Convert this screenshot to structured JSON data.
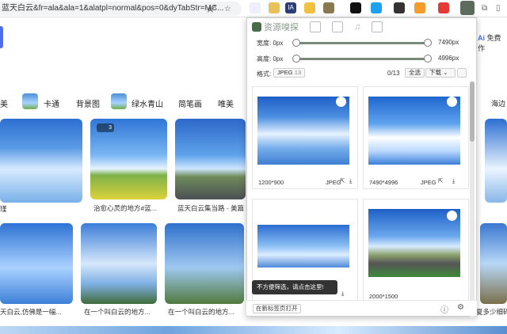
{
  "browser": {
    "url": "蓝天白云&fr=ala&ala=1&alatpl=normal&pos=0&dyTabStr=MC..."
  },
  "page": {
    "categories": [
      "美",
      "卡通",
      "背景图",
      "绿水青山",
      "简笔画",
      "唯美"
    ],
    "right_label": "海边",
    "ai_label": "免费作",
    "overlay_count": "3",
    "captions": [
      "治愈心灵的地方#蓝...",
      "蓝天白云集当路 - 美篇",
      "天白云,仿佛是一幅...",
      "在一个叫白云的地方...",
      "在一个叫白云的地方...",
      "夏多少细碎"
    ]
  },
  "panel": {
    "tabs": [
      "资源嗅探"
    ],
    "width_label": "宽度: 0px",
    "width_max": "7490px",
    "height_label": "高度: 0px",
    "height_max": "4996px",
    "format_label": "格式:",
    "format_value": "JPEG",
    "format_count": "13",
    "count": "0/13",
    "select_all": "全选",
    "download": "下载",
    "cards": [
      {
        "size": "1200*900",
        "format": "JPEG"
      },
      {
        "size": "7490*4996",
        "format": "JPEG"
      },
      {
        "size": "",
        "format": ""
      },
      {
        "size": "2000*1500",
        "format": ""
      }
    ],
    "tooltip": "不方便筛选，请点击这里!",
    "open_new_tab": "在新标签页打开"
  }
}
